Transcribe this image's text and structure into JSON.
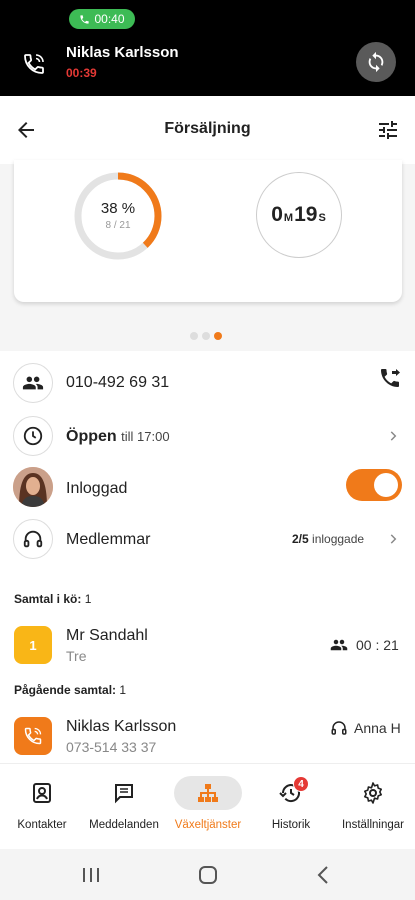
{
  "active_call": {
    "pill_time": "00:40",
    "caller_name": "Niklas Karlsson",
    "timer": "00:39"
  },
  "header": {
    "title": "Försäljning"
  },
  "stats": {
    "answered_percent": "38 %",
    "answered_ratio": "8 / 21",
    "progress": 0.38,
    "wait_minutes": "0",
    "wait_minutes_unit": "M",
    "wait_seconds": "19",
    "wait_seconds_unit": "S"
  },
  "group": {
    "phone": "010-492 69 31",
    "open_status": "Öppen",
    "open_until": "till 17:00",
    "login_status": "Inloggad",
    "members_label": "Medlemmar",
    "members_count": "2/5",
    "members_suffix": "inloggade"
  },
  "queue": {
    "label": "Samtal i kö:",
    "count": "1",
    "item": {
      "position": "1",
      "name": "Mr Sandahl",
      "sub": "Tre",
      "wait": "00 : 21"
    }
  },
  "ongoing": {
    "label": "Pågående samtal:",
    "count": "1",
    "item": {
      "name": "Niklas Karlsson",
      "number": "073-514 33 37",
      "agent": "Anna H"
    }
  },
  "nav": {
    "items": [
      {
        "label": "Kontakter"
      },
      {
        "label": "Meddelanden"
      },
      {
        "label": "Växeltjänster"
      },
      {
        "label": "Historik",
        "badge": "4"
      },
      {
        "label": "Inställningar"
      }
    ]
  },
  "colors": {
    "accent": "#f07a1a",
    "call_green": "#3dbb55",
    "queue_yellow": "#f9b617",
    "alert_red": "#e53935"
  }
}
